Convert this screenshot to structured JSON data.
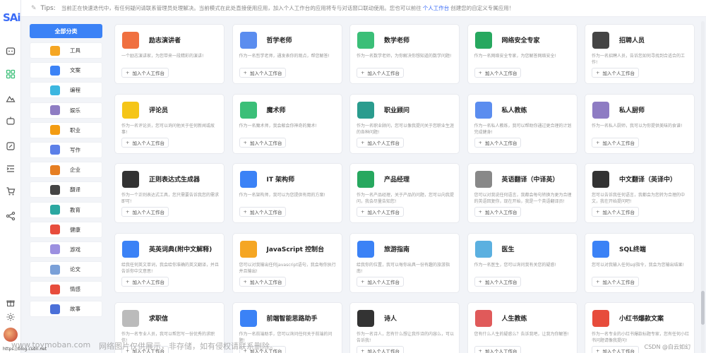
{
  "app": {
    "logo": "SAi"
  },
  "tips": {
    "label": "Tips:",
    "text_before": "当前正在快速迭代中，有任何疑问请联系管理员处理解决。当前模式在此处直接使用应用，加入个人工作台的应用将专与对话窗口联动使用。您也可以前往",
    "link": "个人工作台",
    "text_after": "创建您的自定义专属应用！"
  },
  "categories": {
    "all_label": "全部分类",
    "items": [
      {
        "label": "工具",
        "icon": "toolbox-icon",
        "color": "#f5a623"
      },
      {
        "label": "文案",
        "icon": "document-icon",
        "color": "#3b82f6"
      },
      {
        "label": "编程",
        "icon": "code-icon",
        "color": "#3bb6e0"
      },
      {
        "label": "娱乐",
        "icon": "game-icon",
        "color": "#8e7cc3"
      },
      {
        "label": "职业",
        "icon": "briefcase-icon",
        "color": "#f39c12"
      },
      {
        "label": "写作",
        "icon": "pen-icon",
        "color": "#5b7fe8"
      },
      {
        "label": "企业",
        "icon": "building-icon",
        "color": "#e67e22"
      },
      {
        "label": "翻译",
        "icon": "translate-icon",
        "color": "#444444"
      },
      {
        "label": "教育",
        "icon": "graduation-icon",
        "color": "#2aa7a1"
      },
      {
        "label": "健康",
        "icon": "health-icon",
        "color": "#e74c3c"
      },
      {
        "label": "游戏",
        "icon": "joystick-icon",
        "color": "#9b8fe0"
      },
      {
        "label": "论文",
        "icon": "paper-icon",
        "color": "#7aa0d8"
      },
      {
        "label": "情感",
        "icon": "heart-icon",
        "color": "#e74c3c"
      },
      {
        "label": "故事",
        "icon": "book-icon",
        "color": "#4a6fd8"
      }
    ]
  },
  "add_label": "加入个人工作台",
  "cards": [
    {
      "title": "励志演讲者",
      "desc": "一个励志演讲家，为您带来一段精彩的演讲!",
      "icon": "megaphone-icon",
      "color": "#f07040"
    },
    {
      "title": "哲学老师",
      "desc": "作为一名哲学老师，通发表你的观点，帮您解答!",
      "icon": "feather-icon",
      "color": "#5b8def"
    },
    {
      "title": "数学老师",
      "desc": "作为一名数学老师，为你解决你想知道的数学问题!",
      "icon": "calculator-icon",
      "color": "#3bbf78"
    },
    {
      "title": "网络安全专家",
      "desc": "作为一名网络安全专家，为您解答网络安全!",
      "icon": "globe-icon",
      "color": "#27a85f"
    },
    {
      "title": "招聘人员",
      "desc": "作为一名招聘人员，告诉您如何寻找到合适合的工作!",
      "icon": "recruit-icon",
      "color": "#444444"
    },
    {
      "title": "评论员",
      "desc": "作为一名评论员，您可以询问他关于任何新闻或故事!",
      "icon": "comment-icon",
      "color": "#f5c518"
    },
    {
      "title": "魔术师",
      "desc": "作为一名魔术师，我会献会你神奇的魔术!",
      "icon": "magic-hat-icon",
      "color": "#3bbf78"
    },
    {
      "title": "职业顾问",
      "desc": "作为一名职业顾问，您可以像我提问关于您职业生涯的各种问题!",
      "icon": "person-icon",
      "color": "#2a9c8e"
    },
    {
      "title": "私人教练",
      "desc": "作为一名私人教练，我可以帮助你通过更合理的计划完成健身!",
      "icon": "dumbbell-icon",
      "color": "#5b8def"
    },
    {
      "title": "私人厨师",
      "desc": "作为一名私人厨师，我可以为你提供美味的食谱!",
      "icon": "chef-icon",
      "color": "#8e7cc3"
    },
    {
      "title": "正则表达式生成器",
      "desc": "作为一个正则表达式工具，您只需要告诉我您的需求即可!",
      "icon": "regex-icon",
      "color": "#333333"
    },
    {
      "title": "IT 架构师",
      "desc": "作为一名架构师，我可以为您提供有用的方案!",
      "icon": "architecture-icon",
      "color": "#3b82f6"
    },
    {
      "title": "产品经理",
      "desc": "作为一名产品经理，关于产品的问题，您可以向我提问，我会尽量告知您!",
      "icon": "product-icon",
      "color": "#27a85f"
    },
    {
      "title": "英语翻译（中译英）",
      "desc": "您可以对我说任何语言，我都会每句转换为更为合理的英语回复你，现在开始，我是一个英语翻译员!",
      "icon": "translate-cn-en-icon",
      "color": "#888888"
    },
    {
      "title": "中文翻译（英译中）",
      "desc": "您可以告诉我任何语言，我都会为您转为合理的中文，我在开始提问吧!",
      "icon": "translate-en-cn-icon",
      "color": "#333333"
    },
    {
      "title": "英英词典(附中文解释)",
      "desc": "给我任何英文单词，我会给你准确的英文翻译，并且告诉你中文意思!",
      "icon": "dictionary-icon",
      "color": "#3b82f6"
    },
    {
      "title": "JavaScript 控制台",
      "desc": "您可以对我输出任何javascript语句，我会每你执行并且输出!",
      "icon": "js-icon",
      "color": "#f5a623"
    },
    {
      "title": "旅游指南",
      "desc": "给我你的位置，我可以每你出具一份有趣的旅游指南!",
      "icon": "guidebook-icon",
      "color": "#3b82f6"
    },
    {
      "title": "医生",
      "desc": "作为一名医生，您可以询问我有关您的疑惑!",
      "icon": "doctor-icon",
      "color": "#5bb0e0"
    },
    {
      "title": "SQL终端",
      "desc": "您可以对我输入任何sql指令，我会为您输出结果!",
      "icon": "sql-icon",
      "color": "#3b82f6"
    },
    {
      "title": "求职信",
      "desc": "作为一名专业人员，我可以帮您写一份优秀的求职信!",
      "icon": "letter-icon",
      "color": "#bbbbbb"
    },
    {
      "title": "前端智能思路助手",
      "desc": "作为一名前端助手，您可以询问任何关于前端的问题!",
      "icon": "robot-icon",
      "color": "#3b82f6"
    },
    {
      "title": "诗人",
      "desc": "作为一名诗人，您有什么想让我作诗的内容么，可以告诉我!",
      "icon": "poet-icon",
      "color": "#333333"
    },
    {
      "title": "人生教练",
      "desc": "您有什么人生的疑惑么？告诉我吧，让我为你解答!",
      "icon": "coach-icon",
      "color": "#e05a5a"
    },
    {
      "title": "小红书爆款文案",
      "desc": "作为一名专业的小红书爆款标题专家，您有任何小红书问题请像我提问!",
      "icon": "xhs-icon",
      "color": "#e74c3c"
    }
  ],
  "watermark": {
    "url": "www.toymoban.com",
    "text": "网络图片仅供展示，非存储，如有侵权请联系删除。",
    "small_url": "https://blog.csdn.net",
    "csdn": "CSDN @白云如幻"
  }
}
